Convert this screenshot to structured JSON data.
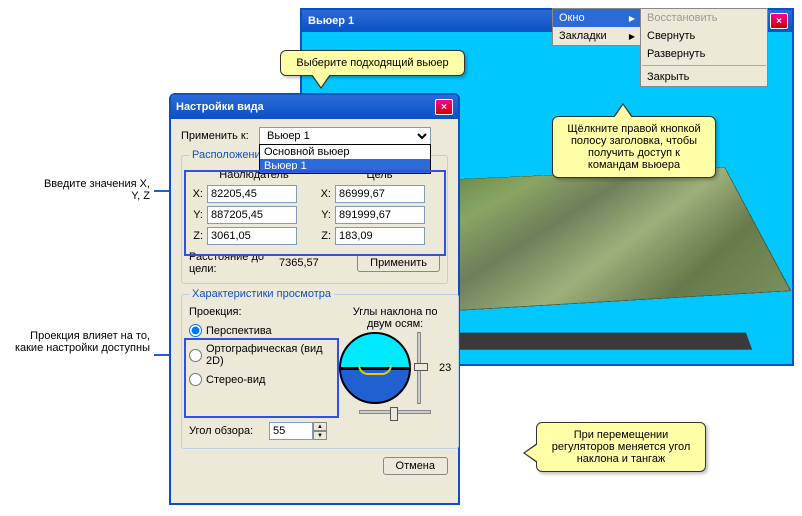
{
  "viewer": {
    "title": "Вьюер 1"
  },
  "context_menu": {
    "window": "Окно",
    "bookmarks": "Закладки",
    "restore": "Восстановить",
    "minimize": "Свернуть",
    "maximize": "Развернуть",
    "close": "Закрыть"
  },
  "dialog": {
    "title": "Настройки вида",
    "apply_to_label": "Применить к:",
    "apply_to_value": "Вьюер 1",
    "apply_to_options": {
      "main": "Основной вьюер",
      "v1": "Вьюер 1"
    },
    "position_legend": "Расположение",
    "observer_label": "Наблюдатель",
    "target_label": "Цель",
    "x_label": "X:",
    "y_label": "Y:",
    "z_label": "Z:",
    "obs_x": "82205,45",
    "obs_y": "887205,45",
    "obs_z": "3061,05",
    "tgt_x": "86999,67",
    "tgt_y": "891999,67",
    "tgt_z": "183,09",
    "dist_label": "Расстояние до цели:",
    "dist_val": "7365,57",
    "apply_btn": "Применить",
    "view_legend": "Характеристики просмотра",
    "projection_label": "Проекция:",
    "proj_perspective": "Перспектива",
    "proj_ortho": "Ортографическая (вид 2D)",
    "proj_stereo": "Стерео-вид",
    "tilt_label": "Углы наклона по двум осям:",
    "tilt_value": "23",
    "fov_label": "Угол обзора:",
    "fov_value": "55",
    "cancel_btn": "Отмена"
  },
  "callouts": {
    "viewer": "Выберите подходящий вьюер",
    "menu": "Щёлкните правой кнопкой полосу заголовка, чтобы получить доступ к командам вьюера",
    "slider": "При перемещении регуляторов меняется угол наклона и тангаж"
  },
  "side_labels": {
    "xyz": "Введите значения X, Y, Z",
    "proj": "Проекция влияет на то, какие настройки доступны"
  }
}
